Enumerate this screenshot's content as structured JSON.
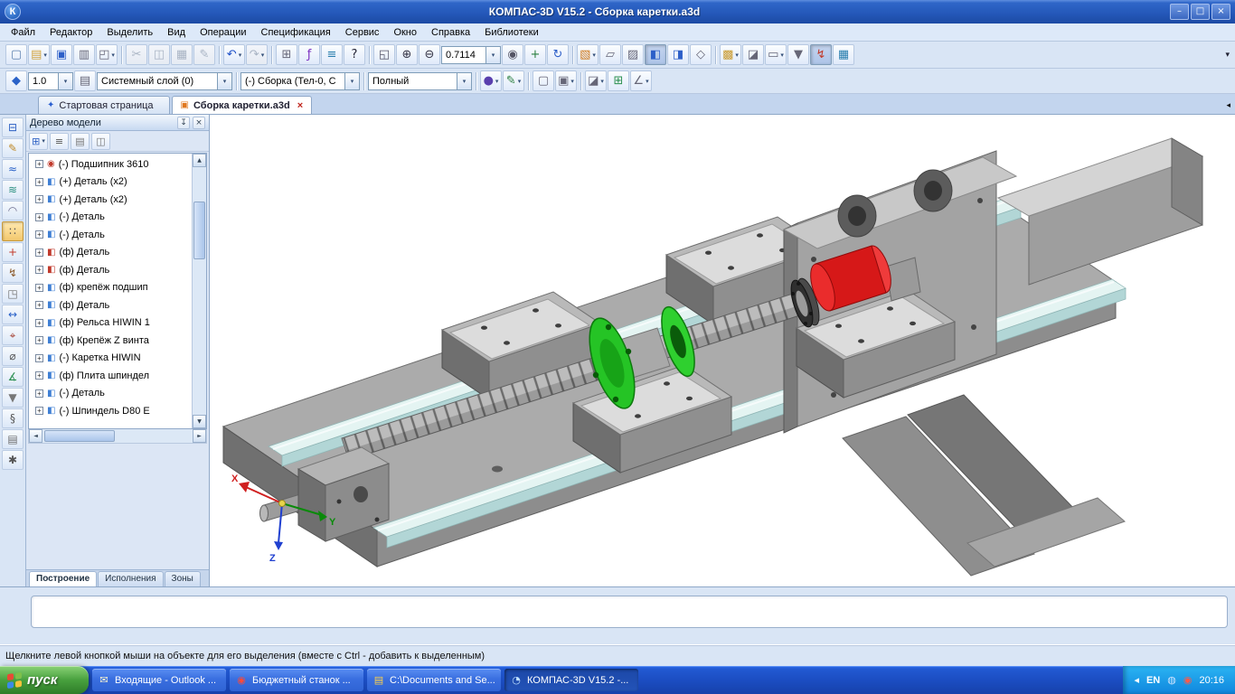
{
  "ui": {
    "dropdown_glyph": "▾",
    "expander_glyph": "+",
    "overflow_glyph": "▾",
    "scroll_up": "▲",
    "scroll_down": "▼",
    "scroll_left": "◄",
    "scroll_right": "►",
    "tab_scroll_glyph": "◂"
  },
  "colors": {
    "titlebar_blue": "#2f62c4",
    "taskbar_blue": "#1b4cc0",
    "start_green": "#48a03e",
    "selected_part_green": "#25c425",
    "selected_part_red": "#d61818",
    "rail_cyan": "#e4f4f2"
  },
  "window": {
    "title": "КОМПАС-3D V15.2  -  Сборка каретки.a3d",
    "app_icon_glyph": "К",
    "controls": [
      {
        "name": "minimize-button",
        "glyph": "–"
      },
      {
        "name": "maximize-button",
        "glyph": "□"
      },
      {
        "name": "close-button",
        "glyph": "×"
      }
    ]
  },
  "menu": {
    "items": [
      "Файл",
      "Редактор",
      "Выделить",
      "Вид",
      "Операции",
      "Спецификация",
      "Сервис",
      "Окно",
      "Справка",
      "Библиотеки"
    ]
  },
  "toolbar_main": {
    "zoom_value": "0.7114",
    "file": [
      {
        "name": "new-document-icon",
        "glyph": "▢",
        "color": "#5a7fae"
      },
      {
        "name": "open-document-icon",
        "glyph": "▤",
        "color": "#d1a23a",
        "dd": true
      },
      {
        "name": "save-icon",
        "glyph": "▣",
        "color": "#2d5fc8"
      },
      {
        "name": "print-icon",
        "glyph": "▥",
        "color": "#667"
      },
      {
        "name": "print-preview-icon",
        "glyph": "◰",
        "color": "#667",
        "dd": true
      }
    ],
    "clipboard": [
      {
        "name": "cut-icon",
        "glyph": "✂",
        "color": "#888",
        "grayed": true
      },
      {
        "name": "copy-icon",
        "glyph": "◫",
        "color": "#888",
        "grayed": true
      },
      {
        "name": "paste-icon",
        "glyph": "▦",
        "color": "#888",
        "grayed": true
      },
      {
        "name": "copy-properties-icon",
        "glyph": "✎",
        "color": "#888",
        "grayed": true
      }
    ],
    "undo": [
      {
        "name": "undo-icon",
        "glyph": "↶",
        "color": "#1d50c8",
        "dd": true
      },
      {
        "name": "redo-icon",
        "glyph": "↷",
        "color": "#99a",
        "grayed": true,
        "dd": true
      }
    ],
    "tools": [
      {
        "name": "preview-layout-icon",
        "glyph": "⊞",
        "color": "#667"
      },
      {
        "name": "variables-icon",
        "glyph": "ƒ",
        "color": "#7a2fc0"
      },
      {
        "name": "relations-icon",
        "glyph": "≡",
        "color": "#2a7fae"
      },
      {
        "name": "context-help-icon",
        "glyph": "?",
        "color": "#223"
      }
    ],
    "zoom_nav": [
      {
        "name": "zoom-window-icon",
        "glyph": "◱",
        "color": "#556"
      },
      {
        "name": "zoom-in-icon",
        "glyph": "⊕",
        "color": "#334"
      },
      {
        "name": "zoom-out-icon",
        "glyph": "⊖",
        "color": "#334"
      }
    ],
    "zoom_extra": [
      {
        "name": "zoom-selected-icon",
        "glyph": "◉",
        "color": "#556"
      },
      {
        "name": "pan-icon",
        "glyph": "+",
        "color": "#2a7f3f"
      },
      {
        "name": "orbit-icon",
        "glyph": "↻",
        "color": "#2d5fc8"
      }
    ],
    "display": [
      {
        "name": "orientation-icon",
        "glyph": "▧",
        "color": "#d07818",
        "dd": true
      },
      {
        "name": "wireframe-icon",
        "glyph": "▱",
        "color": "#667"
      },
      {
        "name": "hidden-lines-icon",
        "glyph": "▨",
        "color": "#667"
      },
      {
        "name": "shaded-icon",
        "glyph": "◧",
        "color": "#2d5fc8",
        "active": true
      },
      {
        "name": "shaded-edges-icon",
        "glyph": "◨",
        "color": "#2d5fc8"
      },
      {
        "name": "perspective-icon",
        "glyph": "◇",
        "color": "#667"
      }
    ],
    "extra": [
      {
        "name": "simplified-display-icon",
        "glyph": "▩",
        "color": "#c99a2e",
        "dd": true
      },
      {
        "name": "section-display-icon",
        "glyph": "◪",
        "color": "#667"
      },
      {
        "name": "hide-objects-icon",
        "glyph": "▭",
        "color": "#667",
        "dd": true
      },
      {
        "name": "selection-filter-icon",
        "glyph": "▼",
        "color": "#667"
      },
      {
        "name": "rebuild-icon",
        "glyph": "↯",
        "color": "#c23a2a",
        "active": true
      },
      {
        "name": "library-manager-icon",
        "glyph": "▦",
        "color": "#2a7fae"
      }
    ]
  },
  "toolbar_view": {
    "step_value": "1.0",
    "layer_value": "Системный слой (0)",
    "target_value": "(-) Сборка (Тел-0, С",
    "quality_value": "Полный",
    "lead": [
      {
        "name": "current-state-icon",
        "glyph": "◆",
        "color": "#2a62c8"
      }
    ],
    "layer_icons": [
      {
        "name": "layers-icon",
        "glyph": "▤",
        "color": "#667"
      }
    ],
    "group_a": [
      {
        "name": "shading-quality-icon",
        "glyph": "●",
        "color": "#5a3fae",
        "dd": true
      },
      {
        "name": "edit-component-icon",
        "glyph": "✎",
        "color": "#2a7f3f",
        "dd": true
      }
    ],
    "group_b": [
      {
        "name": "display-params-icon",
        "glyph": "▢",
        "color": "#667"
      },
      {
        "name": "display-params-alt-icon",
        "glyph": "▣",
        "color": "#667",
        "dd": true
      }
    ],
    "group_c": [
      {
        "name": "section-icon",
        "glyph": "◪",
        "color": "#667",
        "dd": true
      },
      {
        "name": "mesh-icon",
        "glyph": "⊞",
        "color": "#2a8f4f"
      },
      {
        "name": "dimensions-3d-icon",
        "glyph": "∠",
        "color": "#667",
        "dd": true
      }
    ]
  },
  "tabbar": {
    "tabs": [
      {
        "name": "tab-start-page",
        "label": "Стартовая страница",
        "icon_glyph": "✦",
        "icon_color": "#2a5fd0"
      },
      {
        "name": "tab-document",
        "label": "Сборка каретки.a3d",
        "icon_glyph": "▣",
        "icon_color": "#e07820",
        "active": true,
        "close_glyph": "×"
      }
    ]
  },
  "compact_panel": {
    "icons": [
      {
        "name": "panel-model-tree-icon",
        "glyph": "⊟",
        "color": "#2f62c4"
      },
      {
        "name": "panel-sketch-icon",
        "glyph": "✎",
        "color": "#c08a28"
      },
      {
        "name": "panel-geometry-icon",
        "glyph": "≈",
        "color": "#2a62c8"
      },
      {
        "name": "panel-curves-icon",
        "glyph": "≋",
        "color": "#2a8f7f"
      },
      {
        "name": "panel-surfaces-icon",
        "glyph": "◠",
        "color": "#6f6f8f"
      },
      {
        "name": "panel-arrays-icon",
        "glyph": "∷",
        "color": "#555555",
        "active": true
      },
      {
        "name": "panel-auxiliary-icon",
        "glyph": "+",
        "color": "#c23b2b"
      },
      {
        "name": "panel-3d-curves-icon",
        "glyph": "↯",
        "color": "#8a5a2a"
      },
      {
        "name": "panel-sheet-metal-icon",
        "glyph": "◳",
        "color": "#6f6f6f"
      },
      {
        "name": "panel-dimensions-icon",
        "glyph": "↔",
        "color": "#2a62c8"
      },
      {
        "name": "panel-designations-icon",
        "glyph": "⌖",
        "color": "#a33b2b"
      },
      {
        "name": "panel-conditional-icon",
        "glyph": "⌀",
        "color": "#555555"
      },
      {
        "name": "panel-measure-icon",
        "glyph": "∡",
        "color": "#2a8f4f"
      },
      {
        "name": "panel-filters-icon",
        "glyph": "▼",
        "color": "#777777"
      },
      {
        "name": "panel-specification-icon",
        "glyph": "§",
        "color": "#555555"
      },
      {
        "name": "panel-reports-icon",
        "glyph": "▤",
        "color": "#6f6f6f"
      },
      {
        "name": "panel-properties-icon",
        "glyph": "✱",
        "color": "#555555"
      }
    ]
  },
  "tree_panel": {
    "title": "Дерево модели",
    "pin_glyph": "↧",
    "close_glyph": "×",
    "toolbar": [
      {
        "name": "tree-display-mode-icon",
        "glyph": "⊞",
        "color": "#2f62c4",
        "dd": true
      },
      {
        "name": "tree-composition-icon",
        "glyph": "≡",
        "color": "#555555"
      },
      {
        "name": "tree-additional-icon",
        "glyph": "▤",
        "color": "#777777"
      },
      {
        "name": "tree-relations-icon",
        "glyph": "◫",
        "color": "#777777"
      }
    ],
    "items": [
      {
        "label": "(-) Подшипник 3610",
        "icon_glyph": "◉",
        "icon_color": "#c0392b"
      },
      {
        "label": "(+) Деталь (x2)",
        "icon_glyph": "◧",
        "icon_color": "#3f7fd4"
      },
      {
        "label": "(+) Деталь (x2)",
        "icon_glyph": "◧",
        "icon_color": "#3f7fd4"
      },
      {
        "label": "(-) Деталь",
        "icon_glyph": "◧",
        "icon_color": "#3f7fd4"
      },
      {
        "label": "(-) Деталь",
        "icon_glyph": "◧",
        "icon_color": "#3f7fd4"
      },
      {
        "label": "(ф) Деталь",
        "icon_glyph": "◧",
        "icon_color": "#c0392b"
      },
      {
        "label": "(ф) Деталь",
        "icon_glyph": "◧",
        "icon_color": "#c0392b"
      },
      {
        "label": "(ф) крепёж подшип",
        "icon_glyph": "◧",
        "icon_color": "#3f7fd4"
      },
      {
        "label": "(ф) Деталь",
        "icon_glyph": "◧",
        "icon_color": "#3f7fd4"
      },
      {
        "label": "(ф) Рельса HIWIN 1",
        "icon_glyph": "◧",
        "icon_color": "#3f7fd4"
      },
      {
        "label": "(ф) Крепёж Z винта",
        "icon_glyph": "◧",
        "icon_color": "#3f7fd4"
      },
      {
        "label": "(-) Каретка HIWIN",
        "icon_glyph": "◧",
        "icon_color": "#3f7fd4"
      },
      {
        "label": "(ф) Плита шпиндел",
        "icon_glyph": "◧",
        "icon_color": "#3f7fd4"
      },
      {
        "label": "(-) Деталь",
        "icon_glyph": "◧",
        "icon_color": "#3f7fd4"
      },
      {
        "label": "(-) Шпиндель D80 Е",
        "icon_glyph": "◧",
        "icon_color": "#3f7fd4"
      }
    ],
    "bottom_tabs": [
      {
        "label": "Построение",
        "active": true
      },
      {
        "label": "Исполнения"
      },
      {
        "label": "Зоны"
      }
    ]
  },
  "viewport": {
    "triad": {
      "x": "X",
      "y": "Y",
      "z": "Z"
    }
  },
  "status_bar": {
    "text": "Щелкните левой кнопкой мыши на объекте для его выделения (вместе с Ctrl - добавить к выделенным)"
  },
  "taskbar": {
    "start_label": "пуск",
    "buttons": [
      {
        "name": "taskbar-outlook-button",
        "icon_glyph": "✉",
        "icon_color": "#fff8d0",
        "label": "Входящие - Outlook ..."
      },
      {
        "name": "taskbar-opera-button",
        "icon_glyph": "◉",
        "icon_color": "#ff4a3a",
        "label": "Бюджетный станок ..."
      },
      {
        "name": "taskbar-explorer-button",
        "icon_glyph": "▤",
        "icon_color": "#ffd24a",
        "label": "C:\\Documents and Se..."
      },
      {
        "name": "taskbar-kompas-button",
        "icon_glyph": "◔",
        "icon_color": "#bfe0ff",
        "label": "КОМПАС-3D V15.2  -...",
        "active": true
      }
    ],
    "tray": {
      "collapse_glyph": "◂",
      "language": "EN",
      "icons": [
        {
          "name": "tray-update-icon",
          "glyph": "◍",
          "color": "#cfe4ff"
        },
        {
          "name": "tray-opera-icon",
          "glyph": "◉",
          "color": "#ff5a4a"
        }
      ],
      "time": "20:16"
    }
  }
}
